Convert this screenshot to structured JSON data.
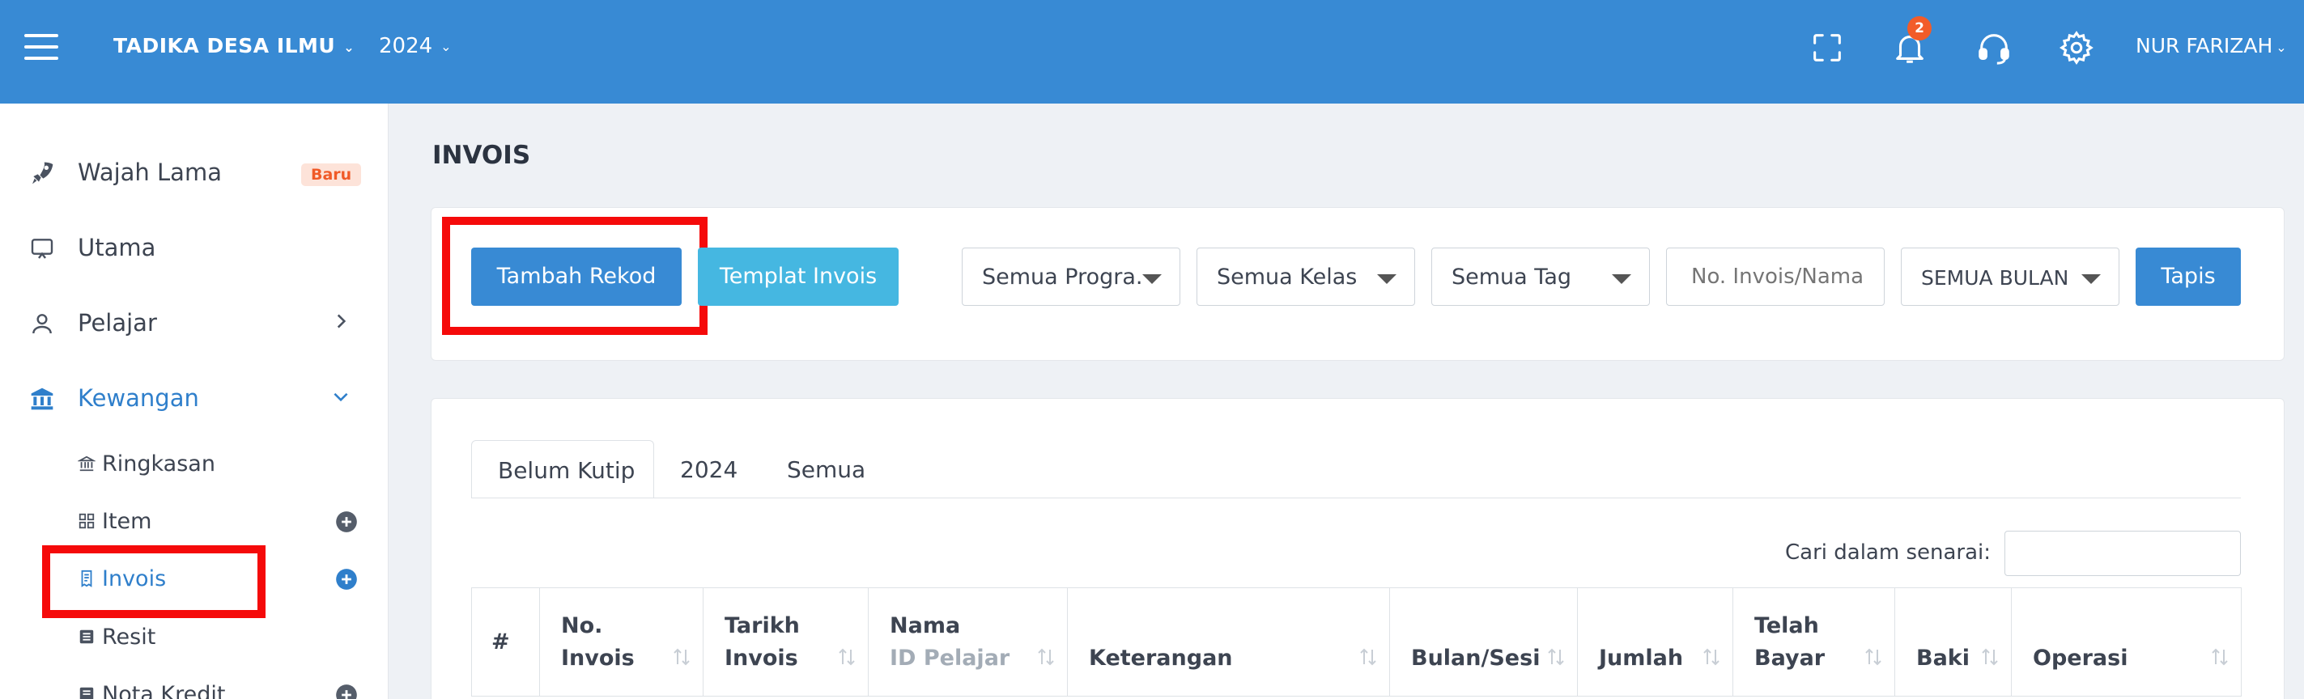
{
  "topbar": {
    "school": "TADIKA DESA ILMU",
    "year": "2024",
    "notification_count": "2",
    "username": "NUR FARIZAH"
  },
  "sidebar": {
    "items": [
      {
        "label": "Wajah Lama",
        "badge": "Baru"
      },
      {
        "label": "Utama"
      },
      {
        "label": "Pelajar"
      },
      {
        "label": "Kewangan"
      }
    ],
    "sub": [
      {
        "label": "Ringkasan"
      },
      {
        "label": "Item"
      },
      {
        "label": "Invois"
      },
      {
        "label": "Resit"
      },
      {
        "label": "Nota Kredit"
      }
    ]
  },
  "page": {
    "title": "INVOIS",
    "add_button": "Tambah Rekod",
    "template_button": "Templat Invois",
    "filter_button": "Tapis",
    "program_select": "Semua Progra...",
    "class_select": "Semua Kelas",
    "tag_select": "Semua Tag",
    "invoice_search_placeholder": "No. Invois/Nama",
    "month_select": "SEMUA BULAN"
  },
  "tabs": [
    "Belum Kutip",
    "2024",
    "Semua"
  ],
  "list": {
    "search_label": "Cari dalam senarai:",
    "columns": {
      "num": "#",
      "invoice_no_1": "No.",
      "invoice_no_2": "Invois",
      "date_1": "Tarikh",
      "date_2": "Invois",
      "name_1": "Nama",
      "name_2": "ID Pelajar",
      "desc": "Keterangan",
      "month": "Bulan/Sesi",
      "amount": "Jumlah",
      "paid_1": "Telah",
      "paid_2": "Bayar",
      "balance": "Baki",
      "ops": "Operasi"
    }
  },
  "colors": {
    "topbar": "#388ad4",
    "primary": "#388ad4",
    "info": "#45b7e1",
    "highlight": "#f50a0a",
    "badge": "#f25c29"
  }
}
